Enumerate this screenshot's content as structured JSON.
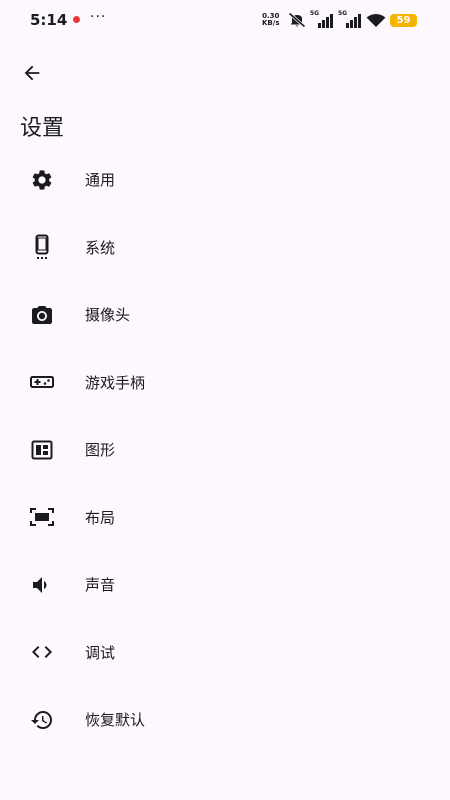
{
  "status_bar": {
    "time": "5:14",
    "net_speed_value": "0.30",
    "net_speed_unit": "KB/s",
    "signal_1_label": "5G",
    "signal_2_label": "5G",
    "battery_level": "59"
  },
  "header": {
    "title": "设置"
  },
  "settings_items": [
    {
      "label": "通用",
      "icon": "gear-icon"
    },
    {
      "label": "系统",
      "icon": "phone-icon"
    },
    {
      "label": "摄像头",
      "icon": "camera-icon"
    },
    {
      "label": "游戏手柄",
      "icon": "gamepad-icon"
    },
    {
      "label": "图形",
      "icon": "graphics-icon"
    },
    {
      "label": "布局",
      "icon": "layout-icon"
    },
    {
      "label": "声音",
      "icon": "speaker-icon"
    },
    {
      "label": "调试",
      "icon": "code-icon"
    },
    {
      "label": "恢复默认",
      "icon": "restore-icon"
    }
  ]
}
